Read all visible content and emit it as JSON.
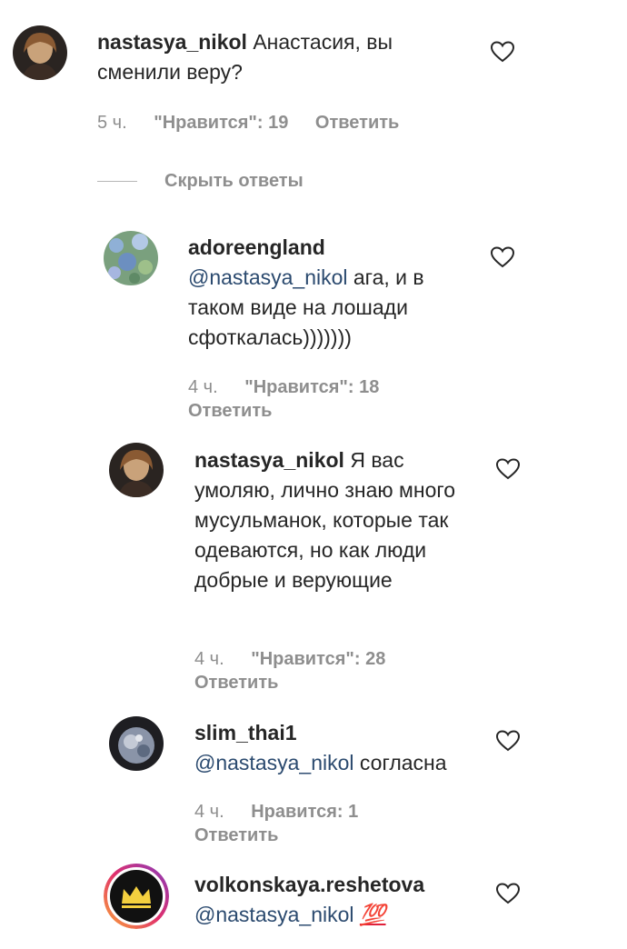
{
  "comments": [
    {
      "username": "nastasya_nikol",
      "text": "Анастасия, вы сменили веру?",
      "time": "5 ч.",
      "likes": "\"Нравится\": 19",
      "reply": "Ответить"
    },
    {
      "username": "adoreengland",
      "mention": "@nastasya_nikol",
      "text": "ага, и в таком виде на лошади сфоткалась)))))))",
      "time": "4 ч.",
      "likes": "\"Нравится\": 18",
      "reply": "Ответить"
    },
    {
      "username": "nastasya_nikol",
      "text": "Я вас умоляю, лично знаю много мусульманок, которые так одеваются, но как люди добрые и верующие",
      "time": "4 ч.",
      "likes": "\"Нравится\": 28",
      "reply": "Ответить"
    },
    {
      "username": "slim_thai1",
      "mention": "@nastasya_nikol",
      "text": "согласна",
      "time": "4 ч.",
      "likes": "Нравится: 1",
      "reply": "Ответить"
    },
    {
      "username": "volkonskaya.reshetova",
      "mention": "@nastasya_nikol",
      "text": "💯"
    }
  ],
  "hide_replies": "Скрыть ответы",
  "icons": {
    "like": "heart-outline-icon",
    "emoji": "hundred-points-icon"
  },
  "colors": {
    "mention": "#2b4a6f",
    "meta": "#8e8e8e",
    "text": "#262626"
  }
}
